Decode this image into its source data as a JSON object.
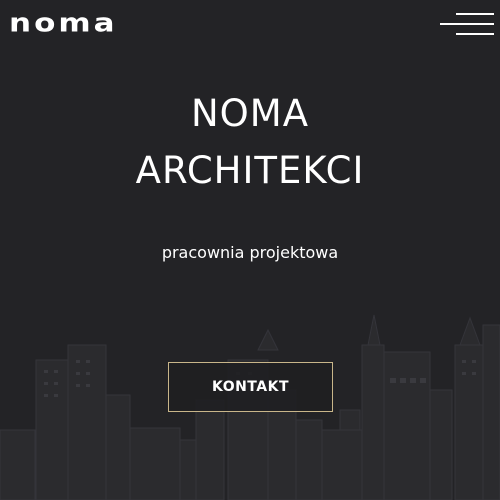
{
  "brand": {
    "logo_text": "noma"
  },
  "menu": {
    "icon": "hamburger-menu-icon"
  },
  "hero": {
    "title_line1": "NOMA",
    "title_line2": "ARCHITEKCI",
    "tagline": "pracownia projektowa",
    "cta_label": "KONTAKT"
  },
  "theme": {
    "background": "#232326",
    "text": "#ffffff",
    "cta_border": "#c9b68a",
    "skyline": "#2e2e31"
  },
  "background_image": {
    "icon": "city-skyline-illustration"
  }
}
